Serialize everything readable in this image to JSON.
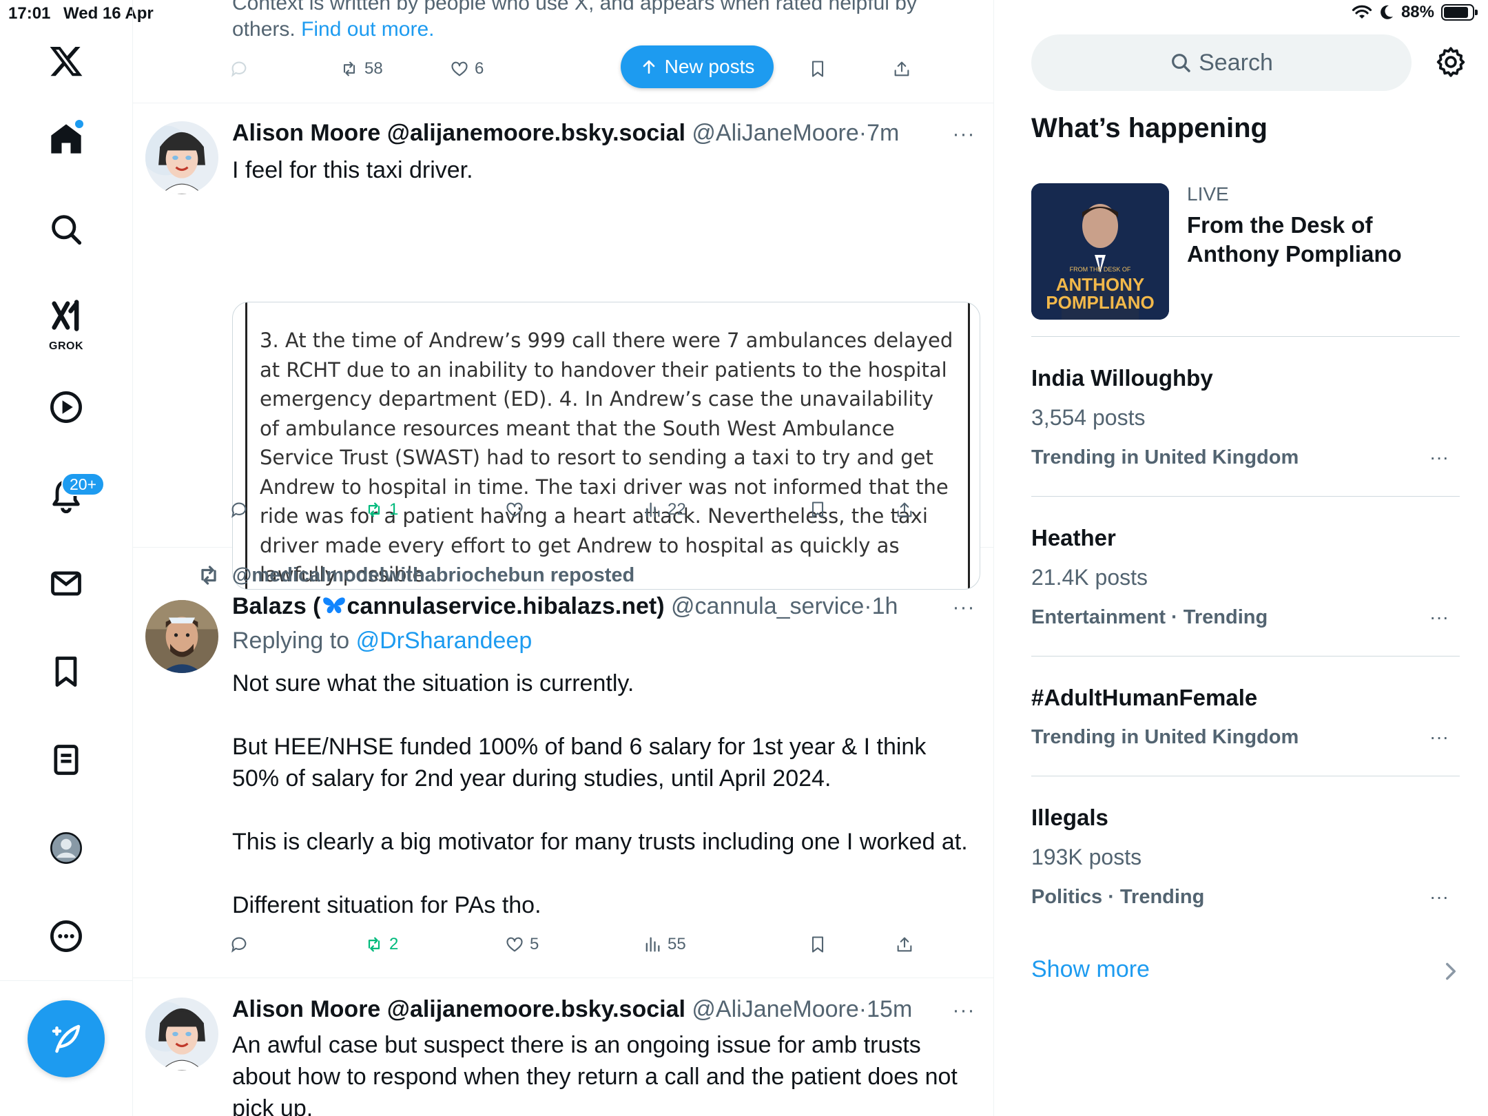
{
  "status_bar": {
    "time": "17:01",
    "date": "Wed 16 Apr",
    "battery": "88%",
    "battery_level": 0.88
  },
  "nav": {
    "notifications_badge": "20+",
    "grok_label": "GROK"
  },
  "timeline": {
    "note": {
      "text": "Context is written by people who use X, and appears when rated helpful by others.",
      "link": "Find out more."
    },
    "new_posts_label": "New posts",
    "top_actions": {
      "reposts": "58",
      "likes": "6"
    },
    "tweets": [
      {
        "display_name": "Alison Moore @alijanemoore.bsky.social",
        "handle": "@AliJaneMoore",
        "time": "7m",
        "text": "I feel for this taxi driver.",
        "image_text": "3.   At the time of Andrew’s 999 call there were 7 ambulances delayed at RCHT due to an inability to handover their patients to the hospital emergency department (ED).  4.   In Andrew’s case the unavailability of ambulance resources meant that the South West Ambulance Service Trust (SWAST) had to resort to sending a taxi to try and  get Andrew to hospital in time. The taxi driver was not informed that the ride was for a patient having a heart attack.  Nevertheless, the taxi driver made every effort to get Andrew to hospital as quickly as lawfully possible.",
        "reposts": "1",
        "views": "22"
      },
      {
        "reposted_by": "@medicalmodelwithabriochebun reposted",
        "display_name_prefix": "Balazs (",
        "display_name_domain": "cannulaservice.hibalazs.net)",
        "handle": "@cannula_service",
        "time": "1h",
        "replying_prefix": "Replying to",
        "replying_to": "@DrSharandeep",
        "text": "Not sure what the situation is currently.\n\nBut HEE/NHSE funded 100% of band 6 salary for 1st year & I think 50% of salary for 2nd year during studies, until April 2024.\n\nThis is clearly a big motivator for many trusts including one I worked at.\n\nDifferent situation for PAs tho.",
        "reposts": "2",
        "likes": "5",
        "views": "55"
      },
      {
        "display_name": "Alison Moore @alijanemoore.bsky.social",
        "handle": "@AliJaneMoore",
        "time": "15m",
        "text": "An awful case but suspect there is an ongoing issue for amb trusts about how to respond when they return a call and the patient does not pick up."
      }
    ]
  },
  "sidebar": {
    "search_placeholder": "Search",
    "section_title": "What’s happening",
    "live": {
      "label": "LIVE",
      "title": "From the Desk of Anthony Pompliano",
      "thumb_small": "FROM THE DESK OF",
      "thumb_line1": "ANTHONY",
      "thumb_line2": "POMPLIANO"
    },
    "trends": [
      {
        "name": "India Willoughby",
        "count": "3,554 posts",
        "meta": "Trending in United Kingdom"
      },
      {
        "name": "Heather",
        "count": "21.4K posts",
        "meta": "Entertainment · Trending"
      },
      {
        "name": "#AdultHumanFemale",
        "count": "",
        "meta": "Trending in United Kingdom"
      },
      {
        "name": "Illegals",
        "count": "193K posts",
        "meta": "Politics · Trending"
      }
    ],
    "show_more": "Show more"
  },
  "colors": {
    "accent": "#1d9bf0",
    "secondary_text": "#536471",
    "repost_green": "#00ba7c",
    "divider": "#eff3f4"
  }
}
